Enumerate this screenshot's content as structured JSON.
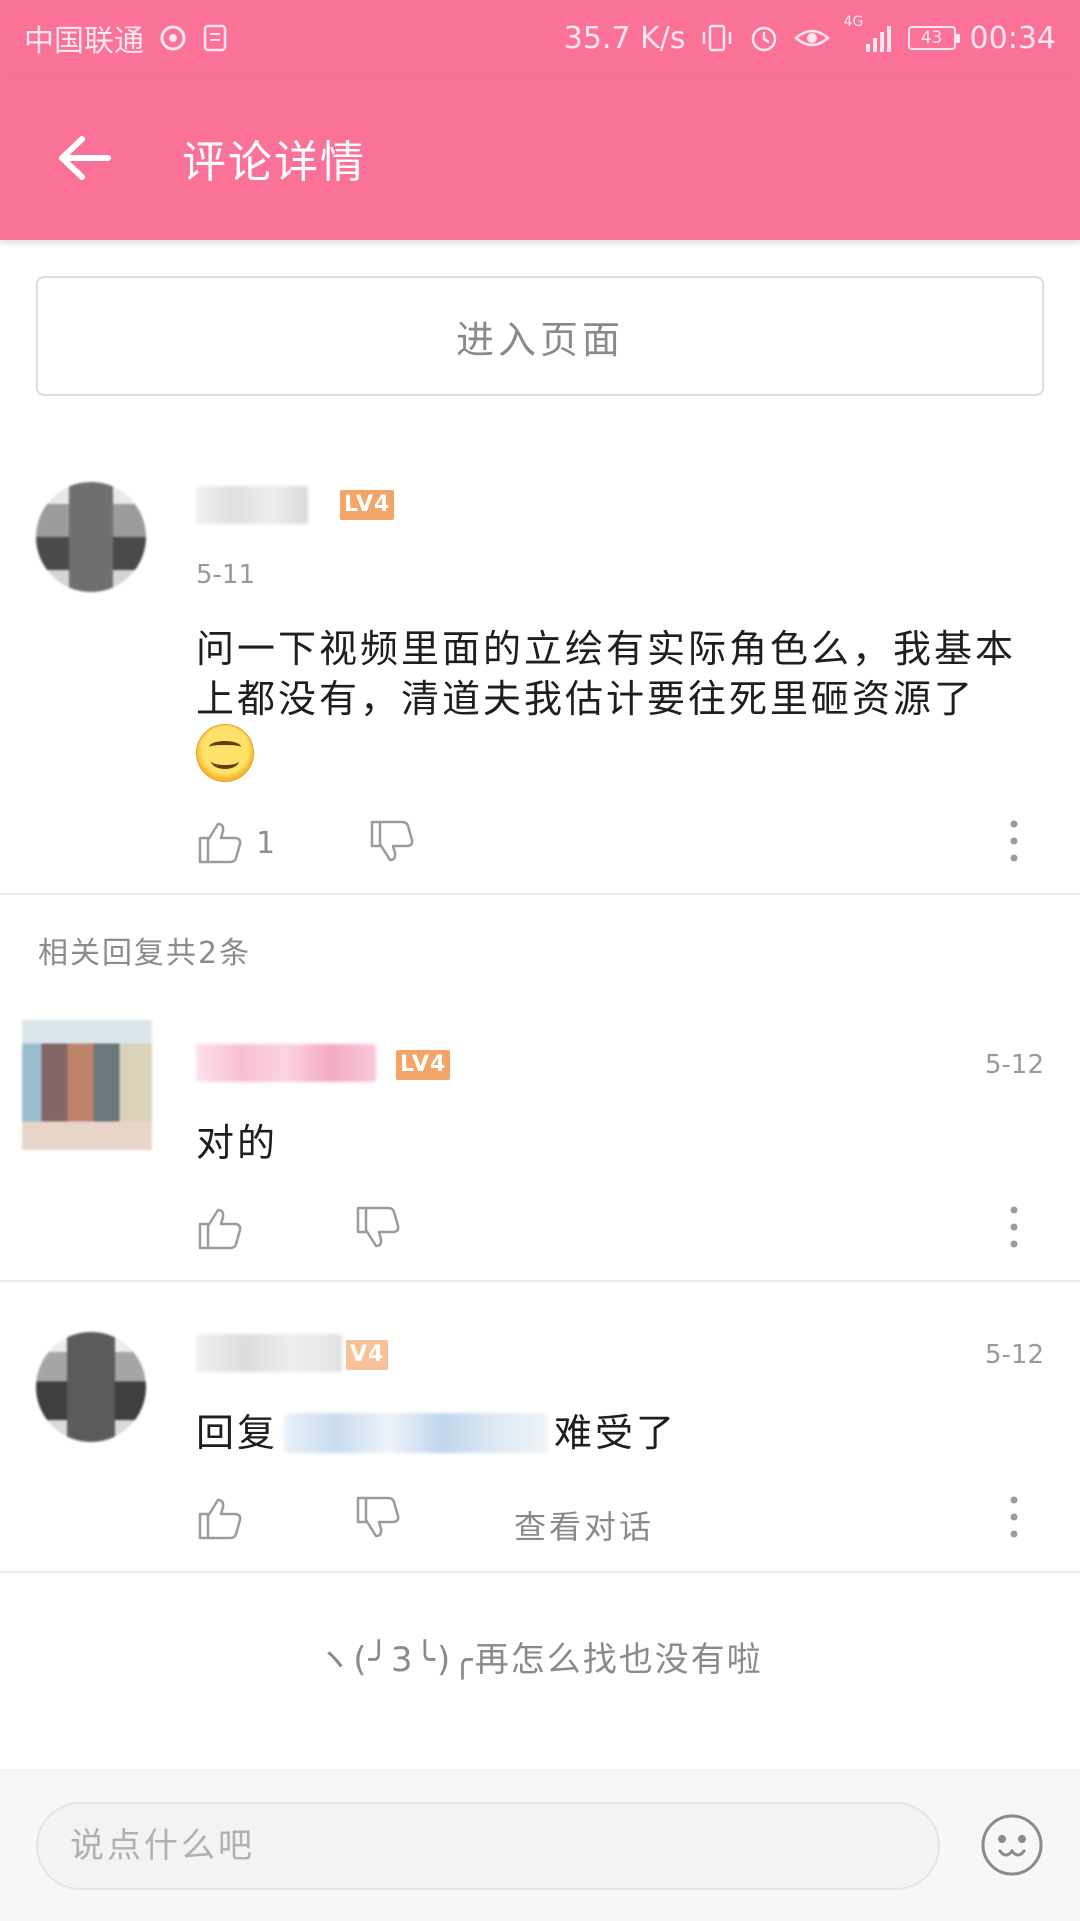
{
  "status_bar": {
    "carrier": "中国联通",
    "speed": "35.7 K/s",
    "network": "4G",
    "battery": "43",
    "time": "00:34"
  },
  "app_bar": {
    "title": "评论详情"
  },
  "enter_page_button": "进入页面",
  "main_comment": {
    "level": "LV4",
    "date": "5-11",
    "text": "问一下视频里面的立绘有实际角色么，我基本上都没有，清道夫我估计要往死里砸资源了",
    "likes": "1"
  },
  "replies_header": "相关回复共2条",
  "replies": [
    {
      "level": "LV4",
      "date": "5-12",
      "text": "对的"
    },
    {
      "level": "V4",
      "date": "5-12",
      "prefix": "回复",
      "suffix": "难受了",
      "view_conversation": "查看对话"
    }
  ],
  "end_message": "ヽ(╯3╰)╭再怎么找也没有啦",
  "comment_input": {
    "placeholder": "说点什么吧"
  },
  "colors": {
    "brand_pink": "#fb7299",
    "level_badge": "#f5a467"
  },
  "icons": {
    "back": "arrow-left-icon",
    "like": "thumb-up-icon",
    "dislike": "thumb-down-icon",
    "more": "more-vertical-icon",
    "emoji": "smiley-face-icon"
  }
}
